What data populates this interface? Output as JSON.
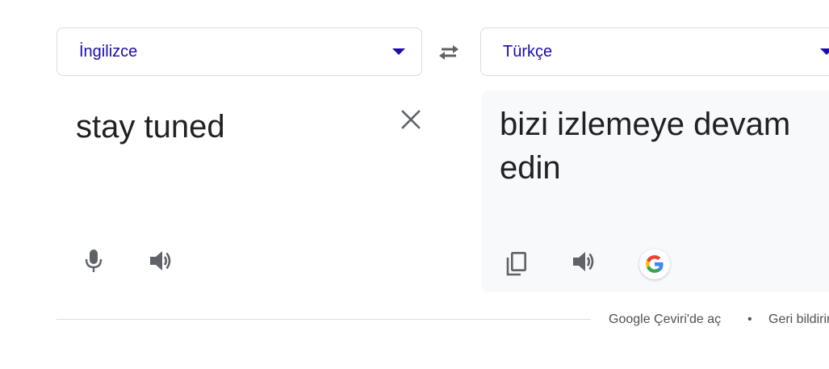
{
  "source_language": {
    "label": "İngilizce",
    "dropdown_icon": "caret-down-icon"
  },
  "target_language": {
    "label": "Türkçe",
    "dropdown_icon": "caret-down-icon"
  },
  "swap_icon": "swap-arrows-icon",
  "source": {
    "text": "stay tuned",
    "clear_icon": "close-icon",
    "mic_icon": "microphone-icon",
    "listen_icon": "speaker-icon"
  },
  "target": {
    "text": "bizi izlemeye devam edin",
    "copy_icon": "copy-icon",
    "listen_icon": "speaker-icon",
    "google_icon": "google-logo-icon"
  },
  "footer": {
    "open_in_translate": "Google Çeviri'de aç",
    "separator": "•",
    "feedback": "Geri bildirim"
  },
  "colors": {
    "language_text": "#1a0dab",
    "icon_gray": "#5f6368",
    "panel_bg": "#f8f9fa",
    "border": "#dadce0"
  }
}
